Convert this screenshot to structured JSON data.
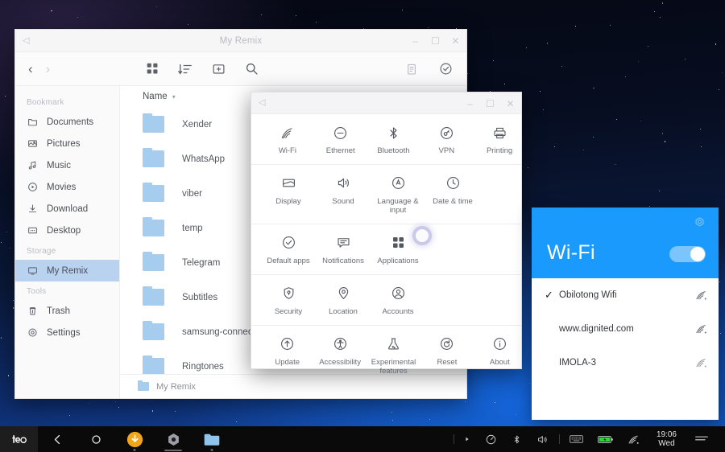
{
  "filemanager": {
    "title": "My Remix",
    "titlebar_controls": [
      "minimize",
      "maximize",
      "close"
    ],
    "nav": {
      "back": "‹",
      "forward": "›"
    },
    "toolbar_icons": [
      {
        "name": "grid-view-icon",
        "label": "Grid view"
      },
      {
        "name": "sort-icon",
        "label": "Sort"
      },
      {
        "name": "new-folder-icon",
        "label": "New folder"
      },
      {
        "name": "search-icon",
        "label": "Search"
      }
    ],
    "toolbar_right_icons": [
      {
        "name": "clipboard-icon",
        "label": "Clipboard"
      },
      {
        "name": "select-check-icon",
        "label": "Select"
      }
    ],
    "sidebar": {
      "sections": [
        {
          "label": "Bookmark",
          "items": [
            {
              "label": "Documents",
              "icon": "document-folder-icon",
              "active": false
            },
            {
              "label": "Pictures",
              "icon": "picture-icon",
              "active": false
            },
            {
              "label": "Music",
              "icon": "music-note-icon",
              "active": false
            },
            {
              "label": "Movies",
              "icon": "play-circle-icon",
              "active": false
            },
            {
              "label": "Download",
              "icon": "download-icon",
              "active": false
            },
            {
              "label": "Desktop",
              "icon": "desktop-icon",
              "active": false
            }
          ]
        },
        {
          "label": "Storage",
          "items": [
            {
              "label": "My Remix",
              "icon": "monitor-icon",
              "active": true
            }
          ]
        },
        {
          "label": "Tools",
          "items": [
            {
              "label": "Trash",
              "icon": "trash-icon",
              "active": false
            },
            {
              "label": "Settings",
              "icon": "settings-gear-icon",
              "active": false
            }
          ]
        }
      ]
    },
    "column_header": "Name",
    "files": [
      {
        "name": "Xender",
        "type": "folder"
      },
      {
        "name": "WhatsApp",
        "type": "folder"
      },
      {
        "name": "viber",
        "type": "folder"
      },
      {
        "name": "temp",
        "type": "folder"
      },
      {
        "name": "Telegram",
        "type": "folder"
      },
      {
        "name": "Subtitles",
        "type": "folder"
      },
      {
        "name": "samsung-connect",
        "type": "folder"
      },
      {
        "name": "Ringtones",
        "type": "folder"
      }
    ],
    "statusbar": {
      "path": "My Remix"
    }
  },
  "settings": {
    "title": "",
    "groups": [
      {
        "items": [
          {
            "label": "Wi-Fi",
            "icon": "wifi-icon"
          },
          {
            "label": "Ethernet",
            "icon": "ethernet-icon"
          },
          {
            "label": "Bluetooth",
            "icon": "bluetooth-icon"
          },
          {
            "label": "VPN",
            "icon": "vpn-key-icon"
          },
          {
            "label": "Printing",
            "icon": "printer-icon"
          }
        ]
      },
      {
        "items": [
          {
            "label": "Display",
            "icon": "display-icon"
          },
          {
            "label": "Sound",
            "icon": "speaker-icon"
          },
          {
            "label": "Language & input",
            "icon": "language-icon"
          },
          {
            "label": "Date & time",
            "icon": "clock-icon"
          }
        ]
      },
      {
        "items": [
          {
            "label": "Default apps",
            "icon": "check-circle-icon"
          },
          {
            "label": "Notifications",
            "icon": "notification-icon"
          },
          {
            "label": "Applications",
            "icon": "apps-grid-icon"
          }
        ]
      },
      {
        "items": [
          {
            "label": "Security",
            "icon": "shield-icon"
          },
          {
            "label": "Location",
            "icon": "location-pin-icon"
          },
          {
            "label": "Accounts",
            "icon": "account-person-icon"
          }
        ]
      },
      {
        "items": [
          {
            "label": "Update",
            "icon": "update-arrow-icon"
          },
          {
            "label": "Accessibility",
            "icon": "accessibility-icon"
          },
          {
            "label": "Experimental features",
            "icon": "flask-icon"
          },
          {
            "label": "Reset",
            "icon": "reset-icon"
          },
          {
            "label": "About",
            "icon": "info-icon"
          }
        ]
      }
    ],
    "cursor": "loading-spinner"
  },
  "wifi_panel": {
    "title": "Wi-Fi",
    "gear_icon": "settings-gear-icon",
    "toggle_on": true,
    "accent_color": "#1a9afc",
    "networks": [
      {
        "ssid": "Obilotong Wifi",
        "connected": true,
        "signal": "signal-icon"
      },
      {
        "ssid": "www.dignited.com",
        "connected": false,
        "signal": "signal-icon"
      },
      {
        "ssid": "IMOLA-3",
        "connected": false,
        "signal": "signal-icon"
      }
    ]
  },
  "taskbar": {
    "logo": "remix-de-logo",
    "apps": [
      {
        "name": "back-button",
        "icon": "chevron-left-icon",
        "running": false
      },
      {
        "name": "home-button",
        "icon": "circle-icon",
        "running": false
      },
      {
        "name": "downloads-app",
        "icon": "download-circle-icon",
        "running": true
      },
      {
        "name": "settings-app",
        "icon": "gear-hex-icon",
        "running": true
      },
      {
        "name": "files-app",
        "icon": "folder-icon",
        "running": true
      }
    ],
    "tray": [
      {
        "name": "expand-tray-icon",
        "icon": "triangle-right"
      },
      {
        "name": "brightness-icon",
        "icon": "brightness"
      },
      {
        "name": "bluetooth-icon",
        "icon": "bluetooth"
      },
      {
        "name": "volume-icon",
        "icon": "speaker"
      },
      {
        "name": "keyboard-icon",
        "icon": "keyboard"
      },
      {
        "name": "battery-icon",
        "icon": "battery"
      },
      {
        "name": "wifi-icon",
        "icon": "wifi"
      }
    ],
    "clock": {
      "time": "19:06",
      "day": "Wed"
    },
    "menu_icon": "hamburger-menu-icon"
  }
}
